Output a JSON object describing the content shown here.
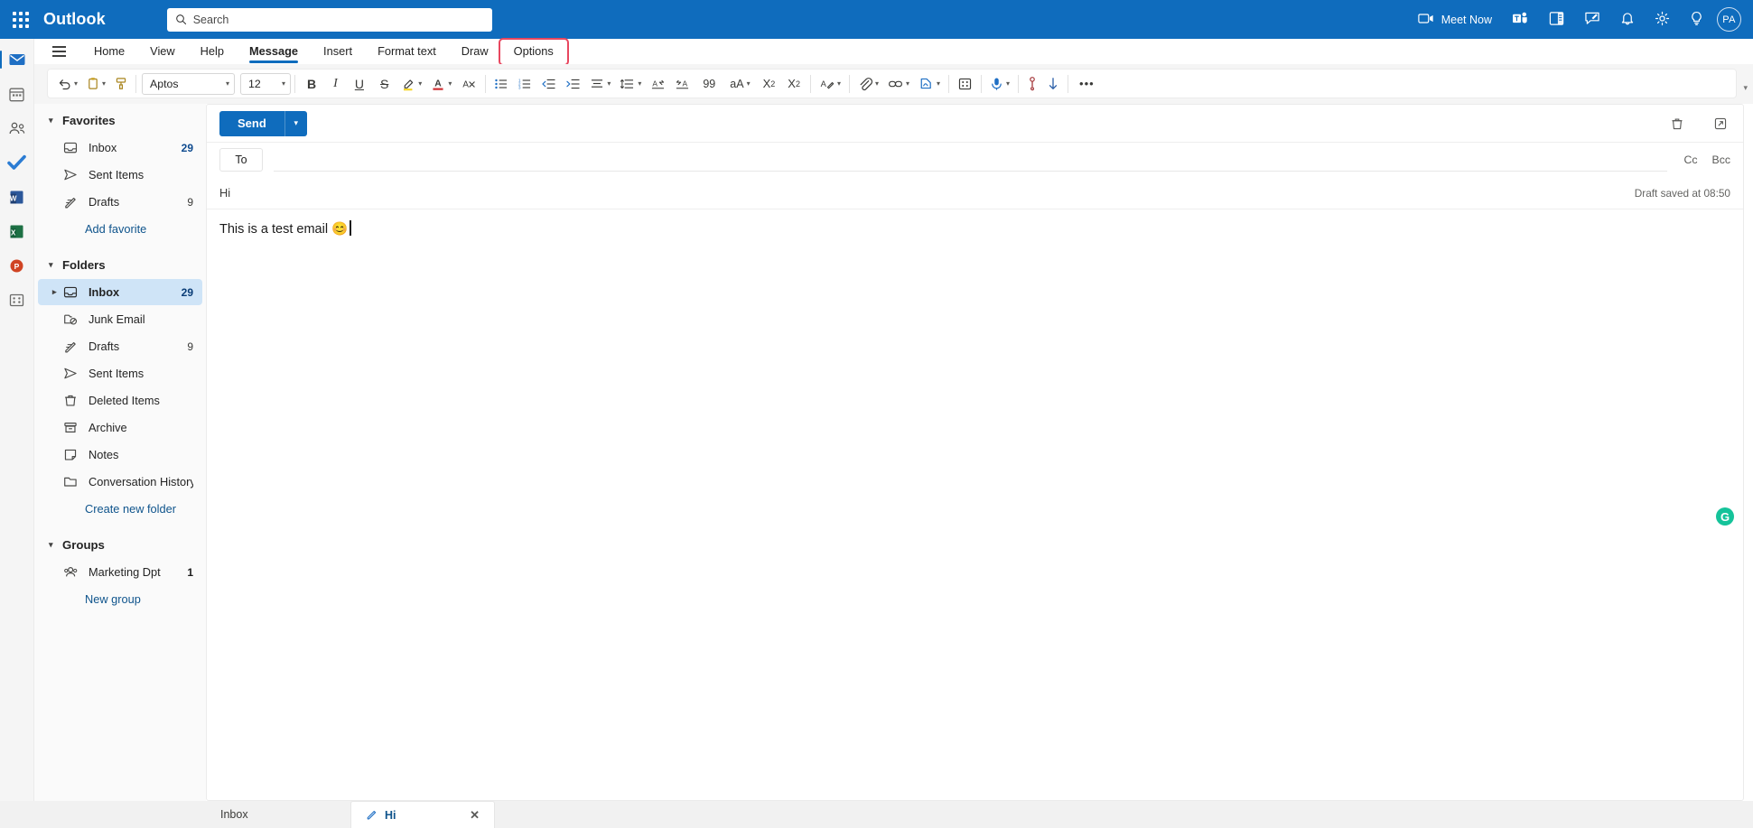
{
  "topbar": {
    "brand": "Outlook",
    "waffle_name": "app-launcher",
    "search": {
      "placeholder": "Search",
      "value": ""
    },
    "meet_now": "Meet Now",
    "avatar_initials": "PA",
    "accent_color": "#0f6cbd"
  },
  "ribbon": {
    "tabs": [
      {
        "label": "Home",
        "active": false,
        "highlighted": false
      },
      {
        "label": "View",
        "active": false,
        "highlighted": false
      },
      {
        "label": "Help",
        "active": false,
        "highlighted": false
      },
      {
        "label": "Message",
        "active": true,
        "highlighted": false
      },
      {
        "label": "Insert",
        "active": false,
        "highlighted": false
      },
      {
        "label": "Format text",
        "active": false,
        "highlighted": false
      },
      {
        "label": "Draw",
        "active": false,
        "highlighted": false
      },
      {
        "label": "Options",
        "active": false,
        "highlighted": true
      }
    ],
    "highlight_color": "#e8475f"
  },
  "toolbar": {
    "font_name": "Aptos",
    "font_size": "12",
    "more_label": "•••",
    "quote_label": "99",
    "case_label": "aA"
  },
  "rail": {
    "items": [
      {
        "name": "mail",
        "active": true
      },
      {
        "name": "calendar",
        "active": false
      },
      {
        "name": "people",
        "active": false
      },
      {
        "name": "to-do",
        "active": false
      },
      {
        "name": "word",
        "active": false
      },
      {
        "name": "excel",
        "active": false
      },
      {
        "name": "powerpoint",
        "active": false
      },
      {
        "name": "more-apps",
        "active": false
      }
    ]
  },
  "sidebar": {
    "favorites": {
      "title": "Favorites",
      "items": [
        {
          "label": "Inbox",
          "count": "29",
          "icon": "inbox-icon"
        },
        {
          "label": "Sent Items",
          "count": "",
          "icon": "sent-icon"
        },
        {
          "label": "Drafts",
          "count": "9",
          "icon": "drafts-icon"
        }
      ],
      "add_link": "Add favorite"
    },
    "folders": {
      "title": "Folders",
      "items": [
        {
          "label": "Inbox",
          "count": "29",
          "icon": "inbox-icon",
          "selected": true,
          "twisty": true
        },
        {
          "label": "Junk Email",
          "count": "",
          "icon": "junk-icon",
          "selected": false,
          "twisty": false
        },
        {
          "label": "Drafts",
          "count": "9",
          "icon": "drafts-icon",
          "selected": false,
          "twisty": false
        },
        {
          "label": "Sent Items",
          "count": "",
          "icon": "sent-icon",
          "selected": false,
          "twisty": false
        },
        {
          "label": "Deleted Items",
          "count": "",
          "icon": "trash-icon",
          "selected": false,
          "twisty": false
        },
        {
          "label": "Archive",
          "count": "",
          "icon": "archive-icon",
          "selected": false,
          "twisty": false
        },
        {
          "label": "Notes",
          "count": "",
          "icon": "notes-icon",
          "selected": false,
          "twisty": false
        },
        {
          "label": "Conversation History",
          "count": "",
          "icon": "folder-icon",
          "selected": false,
          "twisty": false
        }
      ],
      "create_link": "Create new folder"
    },
    "groups": {
      "title": "Groups",
      "items": [
        {
          "label": "Marketing Dpt",
          "count": "1",
          "icon": "group-icon"
        }
      ],
      "new_link": "New group"
    }
  },
  "compose": {
    "send_label": "Send",
    "to_label": "To",
    "to_value": "",
    "cc_label": "Cc",
    "bcc_label": "Bcc",
    "subject": "Hi",
    "draft_status": "Draft saved at 08:50",
    "body_text": "This is a test email 😊",
    "grammarly_label": "G"
  },
  "taskbar": {
    "tabs": [
      {
        "label": "Inbox",
        "active": false,
        "has_pencil": false,
        "closable": false
      },
      {
        "label": "Hi",
        "active": true,
        "has_pencil": true,
        "closable": true
      }
    ],
    "close_glyph": "✕"
  }
}
